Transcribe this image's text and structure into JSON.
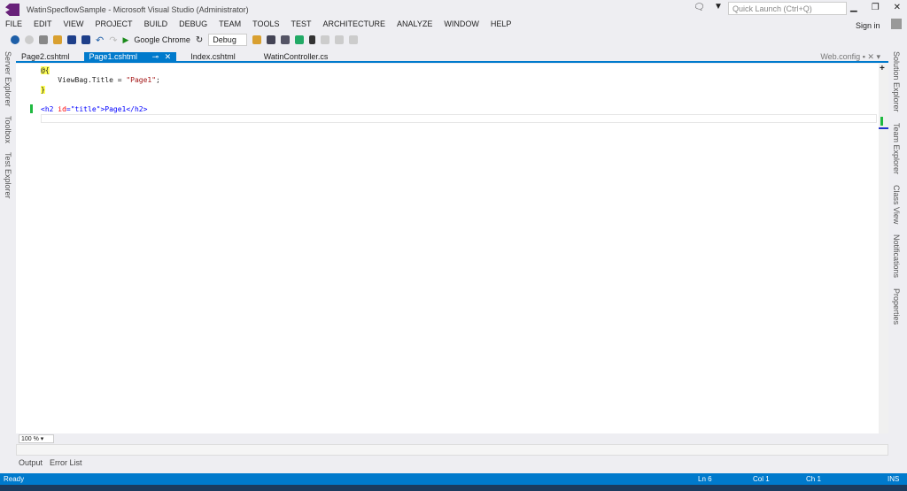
{
  "window": {
    "title": "WatinSpecflowSample - Microsoft Visual Studio (Administrator)",
    "quick_launch_placeholder": "Quick Launch (Ctrl+Q)",
    "sign_in": "Sign in",
    "controls": [
      "▁",
      "❐",
      "✕"
    ]
  },
  "menu": [
    "FILE",
    "EDIT",
    "VIEW",
    "PROJECT",
    "BUILD",
    "DEBUG",
    "TEAM",
    "TOOLS",
    "TEST",
    "ARCHITECTURE",
    "ANALYZE",
    "WINDOW",
    "HELP"
  ],
  "toolbar": {
    "run_target": "Google Chrome",
    "config": "Debug"
  },
  "tabs": [
    "Page2.cshtml",
    "Page1.cshtml",
    "Index.cshtml",
    "WatinController.cs"
  ],
  "active_tab": "Page1.cshtml",
  "pinned_tab": "Web.config",
  "left_panels": [
    "Server Explorer",
    "Toolbox",
    "Test Explorer"
  ],
  "right_panels": [
    "Solution Explorer",
    "Team Explorer",
    "Class View",
    "Notifications",
    "Properties"
  ],
  "code": {
    "l1": "@{",
    "l2a": "    ViewBag.Title = ",
    "l2b": "\"Page1\"",
    "l2c": ";",
    "l3": "}",
    "l5a": "<h2 ",
    "l5b": "id",
    "l5c": "=",
    "l5d": "\"title\"",
    "l5e": ">Page1</h2>"
  },
  "zoom": "100 %",
  "bottom_tabs": [
    "Output",
    "Error List"
  ],
  "status": {
    "text": "Ready",
    "ln": "Ln 6",
    "col": "Col 1",
    "ch": "Ch 1",
    "mode": "INS"
  }
}
